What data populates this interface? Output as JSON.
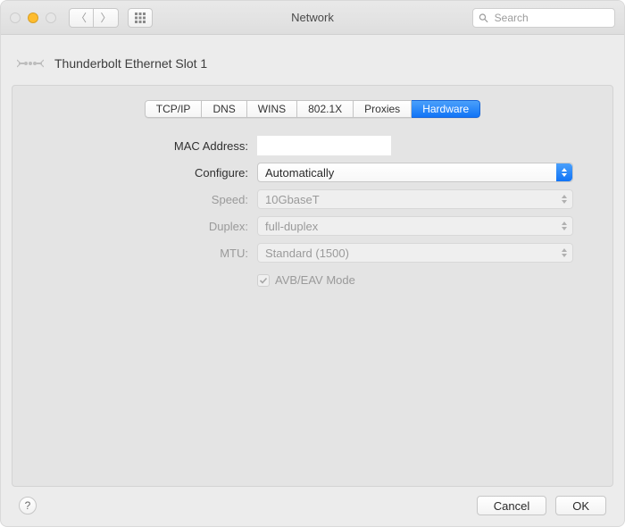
{
  "window": {
    "title": "Network",
    "search_placeholder": "Search"
  },
  "interface": {
    "name": "Thunderbolt Ethernet Slot 1"
  },
  "tabs": [
    {
      "label": "TCP/IP",
      "active": false
    },
    {
      "label": "DNS",
      "active": false
    },
    {
      "label": "WINS",
      "active": false
    },
    {
      "label": "802.1X",
      "active": false
    },
    {
      "label": "Proxies",
      "active": false
    },
    {
      "label": "Hardware",
      "active": true
    }
  ],
  "form": {
    "mac_address": {
      "label": "MAC Address:",
      "value": ""
    },
    "configure": {
      "label": "Configure:",
      "value": "Automatically",
      "enabled": true
    },
    "speed": {
      "label": "Speed:",
      "value": "10GbaseT",
      "enabled": false
    },
    "duplex": {
      "label": "Duplex:",
      "value": "full-duplex",
      "enabled": false
    },
    "mtu": {
      "label": "MTU:",
      "value": "Standard (1500)",
      "enabled": false
    },
    "avb": {
      "label": "AVB/EAV Mode",
      "checked": true,
      "enabled": false
    }
  },
  "buttons": {
    "cancel": "Cancel",
    "ok": "OK",
    "help_tooltip": "Help"
  }
}
